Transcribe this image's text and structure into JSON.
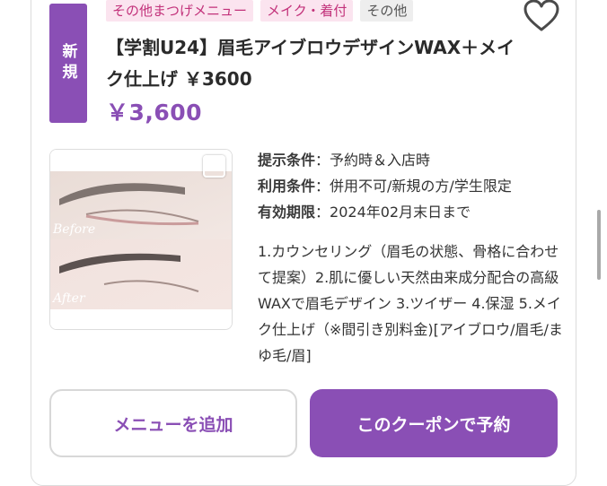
{
  "tags": [
    "その他まつげメニュー",
    "メイク・着付",
    "その他"
  ],
  "badge": "新規",
  "title": "【学割U24】眉毛アイブロウデザインWAX＋メイク仕上げ ￥3600",
  "price": "￥3,600",
  "photo": {
    "before_label": "Before",
    "after_label": "After"
  },
  "conditions": [
    {
      "label": "提示条件",
      "value": "予約時＆入店時"
    },
    {
      "label": "利用条件",
      "value": "併用不可/新規の方/学生限定"
    },
    {
      "label": "有効期限",
      "value": "2024年02月末日まで"
    }
  ],
  "description": "1.カウンセリング（眉毛の状態、骨格に合わせて提案）2.肌に優しい天然由来成分配合の高級WAXで眉毛デザイン 3.ツイザー 4.保湿 5.メイク仕上げ（※間引き別料金)[アイブロウ/眉毛/まゆ毛/眉]",
  "buttons": {
    "add_menu": "メニューを追加",
    "reserve": "このクーポンで予約"
  },
  "icons": {
    "favorite": "heart-icon",
    "select": "checkbox-icon"
  },
  "colors": {
    "accent": "#8a4fb5",
    "tag_pink_bg": "#fbe4ef",
    "tag_pink_text": "#c2317a"
  }
}
